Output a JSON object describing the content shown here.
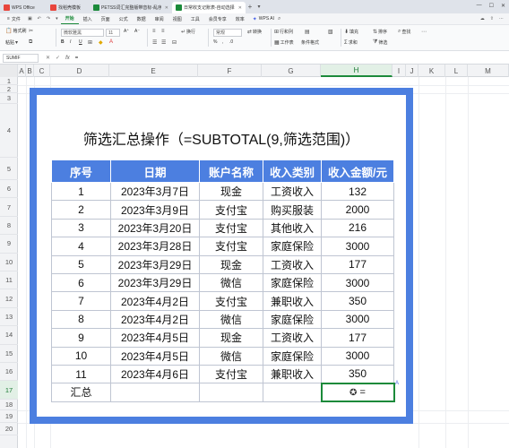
{
  "tabs": [
    {
      "label": "WPS Office",
      "icon": "wps-logo-icon",
      "color": "#e8453c"
    },
    {
      "label": "找稻壳模板",
      "icon": "docer-icon",
      "color": "#e8453c"
    },
    {
      "label": "PETSS词汇完整版带音标-乱序版.pdf",
      "icon": "sheet-file-icon",
      "color": "#1b8a3a"
    },
    {
      "label": "日常收支记账表-自动选择1",
      "icon": "sheet-file-icon",
      "color": "#1b8a3a",
      "active": true
    }
  ],
  "menu": {
    "file": "文件",
    "items": [
      "开始",
      "插入",
      "页面",
      "公式",
      "数据",
      "审阅",
      "视图",
      "工具",
      "会员专享",
      "效率"
    ],
    "active_index": 0,
    "wps_ai": "WPS AI"
  },
  "ribbon": {
    "format_painter": "格式刷",
    "paste": "粘贴",
    "font_name": "微软雅黑",
    "font_size": "11",
    "wrap": "换行",
    "general": "常规",
    "convert": "转换",
    "rows_cols": "行和列",
    "worksheet": "工作表",
    "cond_format": "条件格式",
    "fill": "填充",
    "sum": "求和",
    "sort": "排序",
    "filter": "筛选",
    "find": "查找"
  },
  "formula_bar": {
    "name_box": "SUMIF",
    "fx_label": "fx",
    "content": "="
  },
  "grid": {
    "columns": [
      "A",
      "B",
      "C",
      "D",
      "E",
      "F",
      "G",
      "H",
      "I",
      "J",
      "K",
      "L",
      "M"
    ],
    "selected_column": "H",
    "rows": [
      "1",
      "2",
      "3",
      "4",
      "5",
      "6",
      "7",
      "8",
      "9",
      "10",
      "11",
      "12",
      "13",
      "14",
      "15",
      "16",
      "17",
      "18",
      "19",
      "20"
    ],
    "selected_row": "17"
  },
  "sheet": {
    "title": "筛选汇总操作（=SUBTOTAL(9,筛选范围)）",
    "headers": [
      "序号",
      "日期",
      "账户名称",
      "收入类别",
      "收入金额/元"
    ],
    "rows": [
      [
        "1",
        "2023年3月7日",
        "现金",
        "工资收入",
        "132"
      ],
      [
        "2",
        "2023年3月9日",
        "支付宝",
        "购买服装",
        "2000"
      ],
      [
        "3",
        "2023年3月20日",
        "支付宝",
        "其他收入",
        "216"
      ],
      [
        "4",
        "2023年3月28日",
        "支付宝",
        "家庭保险",
        "3000"
      ],
      [
        "5",
        "2023年3月29日",
        "现金",
        "工资收入",
        "177"
      ],
      [
        "6",
        "2023年3月29日",
        "微信",
        "家庭保险",
        "3000"
      ],
      [
        "7",
        "2023年4月2日",
        "支付宝",
        "兼职收入",
        "350"
      ],
      [
        "8",
        "2023年4月2日",
        "微信",
        "家庭保险",
        "3000"
      ],
      [
        "9",
        "2023年4月5日",
        "现金",
        "工资收入",
        "177"
      ],
      [
        "10",
        "2023年4月5日",
        "微信",
        "家庭保险",
        "3000"
      ],
      [
        "11",
        "2023年4月6日",
        "支付宝",
        "兼职收入",
        "350"
      ]
    ],
    "summary_label": "汇总",
    "summary_value": "=",
    "summary_cursor": "✪"
  },
  "colors": {
    "accent_green": "#1b8a3a",
    "frame_blue": "#4c7fe0",
    "header_text": "#ffffff"
  }
}
